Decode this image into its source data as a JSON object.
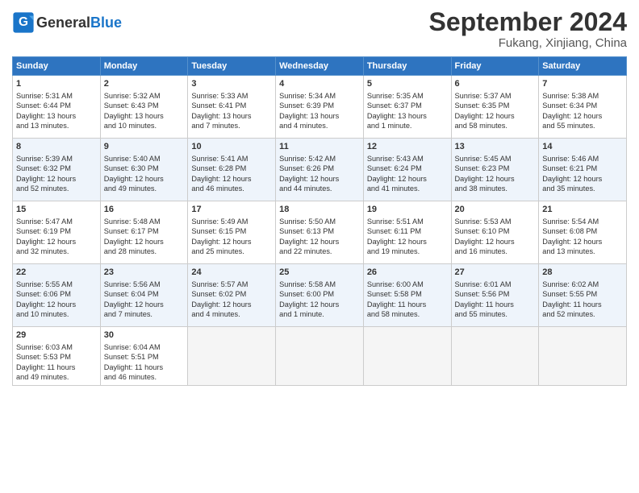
{
  "header": {
    "logo_general": "General",
    "logo_blue": "Blue",
    "month_title": "September 2024",
    "location": "Fukang, Xinjiang, China"
  },
  "weekdays": [
    "Sunday",
    "Monday",
    "Tuesday",
    "Wednesday",
    "Thursday",
    "Friday",
    "Saturday"
  ],
  "weeks": [
    [
      {
        "day": 1,
        "lines": [
          "Sunrise: 5:31 AM",
          "Sunset: 6:44 PM",
          "Daylight: 13 hours",
          "and 13 minutes."
        ]
      },
      {
        "day": 2,
        "lines": [
          "Sunrise: 5:32 AM",
          "Sunset: 6:43 PM",
          "Daylight: 13 hours",
          "and 10 minutes."
        ]
      },
      {
        "day": 3,
        "lines": [
          "Sunrise: 5:33 AM",
          "Sunset: 6:41 PM",
          "Daylight: 13 hours",
          "and 7 minutes."
        ]
      },
      {
        "day": 4,
        "lines": [
          "Sunrise: 5:34 AM",
          "Sunset: 6:39 PM",
          "Daylight: 13 hours",
          "and 4 minutes."
        ]
      },
      {
        "day": 5,
        "lines": [
          "Sunrise: 5:35 AM",
          "Sunset: 6:37 PM",
          "Daylight: 13 hours",
          "and 1 minute."
        ]
      },
      {
        "day": 6,
        "lines": [
          "Sunrise: 5:37 AM",
          "Sunset: 6:35 PM",
          "Daylight: 12 hours",
          "and 58 minutes."
        ]
      },
      {
        "day": 7,
        "lines": [
          "Sunrise: 5:38 AM",
          "Sunset: 6:34 PM",
          "Daylight: 12 hours",
          "and 55 minutes."
        ]
      }
    ],
    [
      {
        "day": 8,
        "lines": [
          "Sunrise: 5:39 AM",
          "Sunset: 6:32 PM",
          "Daylight: 12 hours",
          "and 52 minutes."
        ]
      },
      {
        "day": 9,
        "lines": [
          "Sunrise: 5:40 AM",
          "Sunset: 6:30 PM",
          "Daylight: 12 hours",
          "and 49 minutes."
        ]
      },
      {
        "day": 10,
        "lines": [
          "Sunrise: 5:41 AM",
          "Sunset: 6:28 PM",
          "Daylight: 12 hours",
          "and 46 minutes."
        ]
      },
      {
        "day": 11,
        "lines": [
          "Sunrise: 5:42 AM",
          "Sunset: 6:26 PM",
          "Daylight: 12 hours",
          "and 44 minutes."
        ]
      },
      {
        "day": 12,
        "lines": [
          "Sunrise: 5:43 AM",
          "Sunset: 6:24 PM",
          "Daylight: 12 hours",
          "and 41 minutes."
        ]
      },
      {
        "day": 13,
        "lines": [
          "Sunrise: 5:45 AM",
          "Sunset: 6:23 PM",
          "Daylight: 12 hours",
          "and 38 minutes."
        ]
      },
      {
        "day": 14,
        "lines": [
          "Sunrise: 5:46 AM",
          "Sunset: 6:21 PM",
          "Daylight: 12 hours",
          "and 35 minutes."
        ]
      }
    ],
    [
      {
        "day": 15,
        "lines": [
          "Sunrise: 5:47 AM",
          "Sunset: 6:19 PM",
          "Daylight: 12 hours",
          "and 32 minutes."
        ]
      },
      {
        "day": 16,
        "lines": [
          "Sunrise: 5:48 AM",
          "Sunset: 6:17 PM",
          "Daylight: 12 hours",
          "and 28 minutes."
        ]
      },
      {
        "day": 17,
        "lines": [
          "Sunrise: 5:49 AM",
          "Sunset: 6:15 PM",
          "Daylight: 12 hours",
          "and 25 minutes."
        ]
      },
      {
        "day": 18,
        "lines": [
          "Sunrise: 5:50 AM",
          "Sunset: 6:13 PM",
          "Daylight: 12 hours",
          "and 22 minutes."
        ]
      },
      {
        "day": 19,
        "lines": [
          "Sunrise: 5:51 AM",
          "Sunset: 6:11 PM",
          "Daylight: 12 hours",
          "and 19 minutes."
        ]
      },
      {
        "day": 20,
        "lines": [
          "Sunrise: 5:53 AM",
          "Sunset: 6:10 PM",
          "Daylight: 12 hours",
          "and 16 minutes."
        ]
      },
      {
        "day": 21,
        "lines": [
          "Sunrise: 5:54 AM",
          "Sunset: 6:08 PM",
          "Daylight: 12 hours",
          "and 13 minutes."
        ]
      }
    ],
    [
      {
        "day": 22,
        "lines": [
          "Sunrise: 5:55 AM",
          "Sunset: 6:06 PM",
          "Daylight: 12 hours",
          "and 10 minutes."
        ]
      },
      {
        "day": 23,
        "lines": [
          "Sunrise: 5:56 AM",
          "Sunset: 6:04 PM",
          "Daylight: 12 hours",
          "and 7 minutes."
        ]
      },
      {
        "day": 24,
        "lines": [
          "Sunrise: 5:57 AM",
          "Sunset: 6:02 PM",
          "Daylight: 12 hours",
          "and 4 minutes."
        ]
      },
      {
        "day": 25,
        "lines": [
          "Sunrise: 5:58 AM",
          "Sunset: 6:00 PM",
          "Daylight: 12 hours",
          "and 1 minute."
        ]
      },
      {
        "day": 26,
        "lines": [
          "Sunrise: 6:00 AM",
          "Sunset: 5:58 PM",
          "Daylight: 11 hours",
          "and 58 minutes."
        ]
      },
      {
        "day": 27,
        "lines": [
          "Sunrise: 6:01 AM",
          "Sunset: 5:56 PM",
          "Daylight: 11 hours",
          "and 55 minutes."
        ]
      },
      {
        "day": 28,
        "lines": [
          "Sunrise: 6:02 AM",
          "Sunset: 5:55 PM",
          "Daylight: 11 hours",
          "and 52 minutes."
        ]
      }
    ],
    [
      {
        "day": 29,
        "lines": [
          "Sunrise: 6:03 AM",
          "Sunset: 5:53 PM",
          "Daylight: 11 hours",
          "and 49 minutes."
        ]
      },
      {
        "day": 30,
        "lines": [
          "Sunrise: 6:04 AM",
          "Sunset: 5:51 PM",
          "Daylight: 11 hours",
          "and 46 minutes."
        ]
      },
      null,
      null,
      null,
      null,
      null
    ]
  ]
}
